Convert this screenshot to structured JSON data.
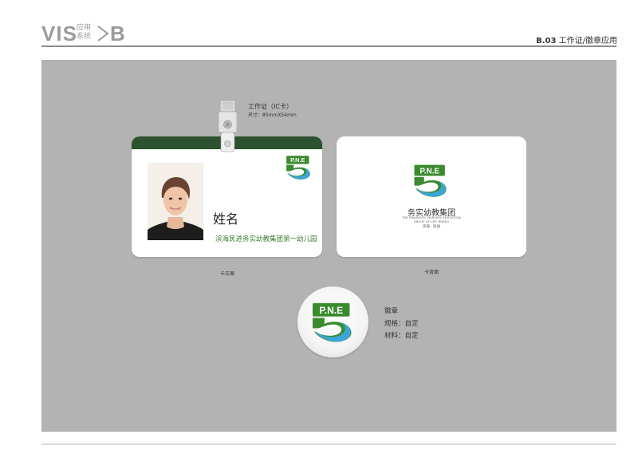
{
  "header": {
    "vis": "VIS",
    "small_line1": "应用",
    "small_line2": "系统",
    "b": "B",
    "code": "B.03",
    "title": "工作证/徽章应用"
  },
  "spec": {
    "title": "工作证（IC卡）",
    "size": "尺寸：85mmX54mm"
  },
  "card_front": {
    "logo_text": "P.N.E",
    "name": "姓名",
    "school": "滨海民进务实幼教集团第一幼儿园",
    "caption": "卡正面"
  },
  "card_back": {
    "logo_text": "P.N.E",
    "cn_name": "务实幼教集团",
    "en_line1": "THE PRAGMATIC NURSERY EDUCATION",
    "en_line2": "GROUP OF CPP. BINHAI",
    "sub": "滨海 · 民进",
    "caption": "卡背面"
  },
  "badge": {
    "logo_text": "P.N.E",
    "title": "徽章",
    "spec": "规格：自定",
    "material": "材料：自定"
  },
  "colors": {
    "brand_green": "#3a8a2e",
    "dark_green": "#2c5230",
    "brand_blue": "#3aa6d8",
    "panel_gray": "#b3b3b3"
  }
}
